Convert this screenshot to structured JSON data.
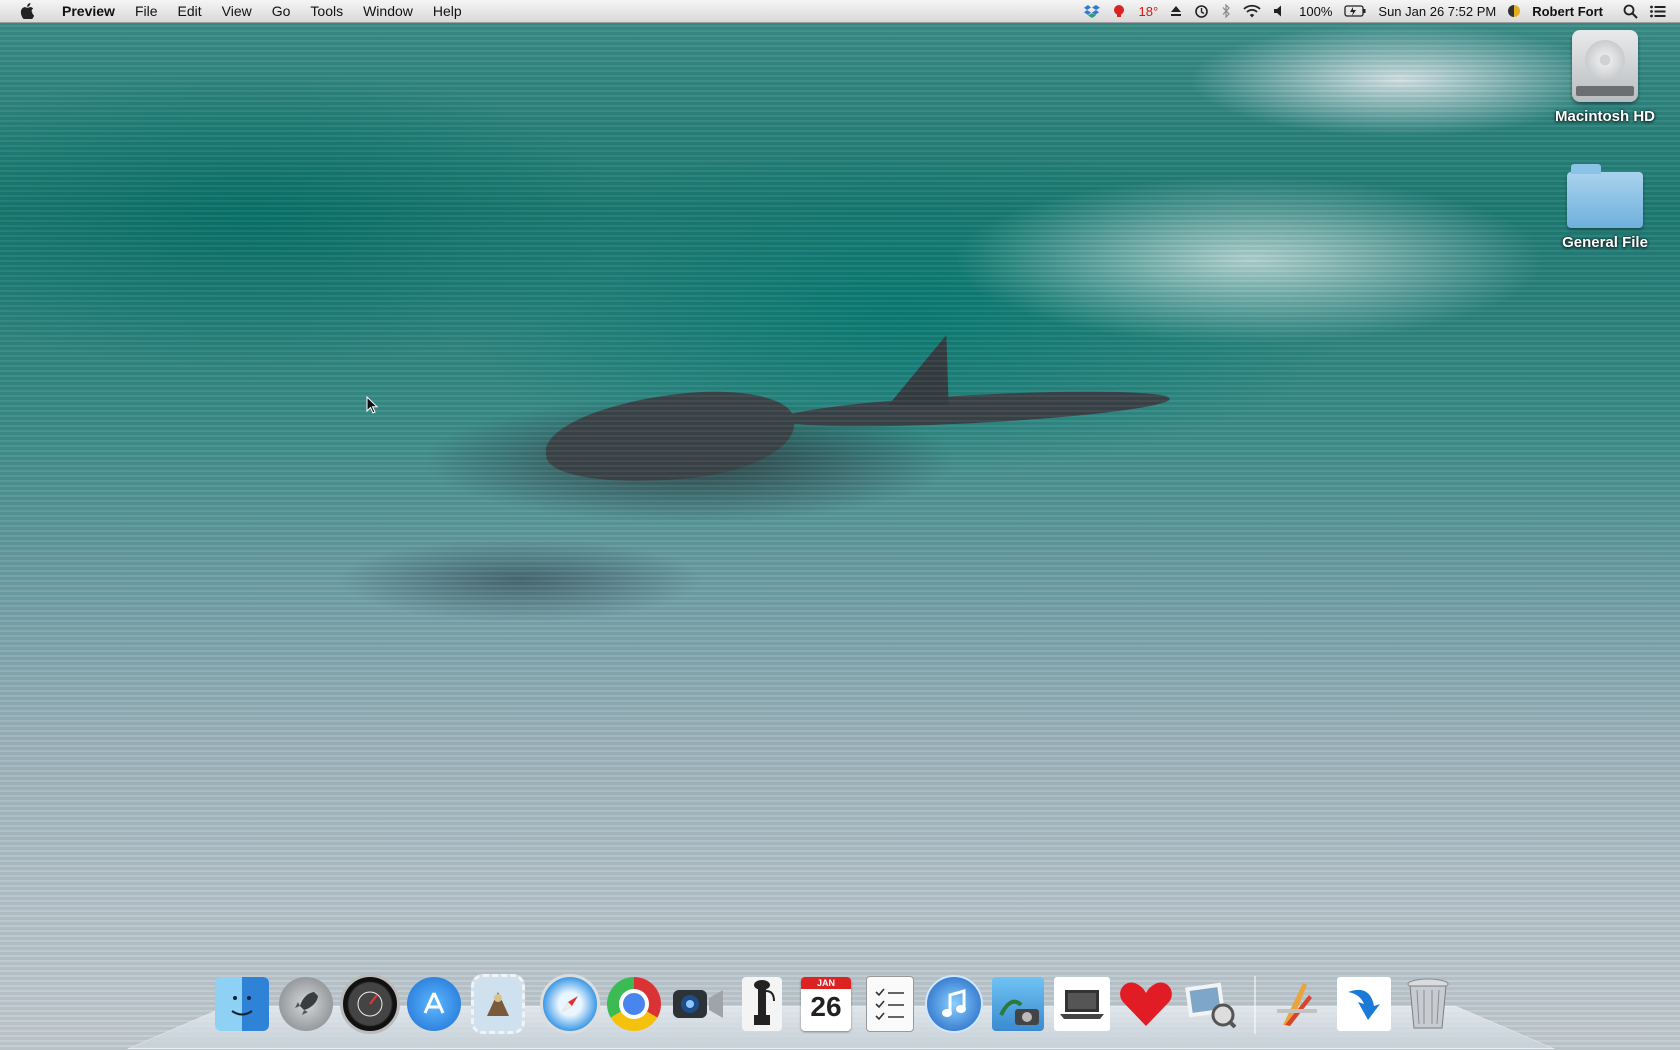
{
  "menubar": {
    "app_name": "Preview",
    "menus": [
      "File",
      "Edit",
      "View",
      "Go",
      "Tools",
      "Window",
      "Help"
    ],
    "status": {
      "temperature": "18°",
      "battery": "100%",
      "datetime": "Sun Jan 26  7:52 PM",
      "user": "Robert Fort"
    }
  },
  "desktop_icons": {
    "hd": "Macintosh HD",
    "folder": "General File"
  },
  "dock": {
    "calendar": {
      "month": "JAN",
      "day": "26"
    },
    "items": [
      "Finder",
      "Launchpad",
      "Dashboard",
      "App Store",
      "Mail",
      "Safari",
      "Google Chrome",
      "FaceTime",
      "Phone Utility",
      "Calendar",
      "Reminders",
      "iTunes",
      "iPhoto",
      "Laptop Utility",
      "Favorites",
      "Preview",
      "Xcode",
      "Downloads",
      "Trash"
    ]
  },
  "colors": {
    "menubar_bg": "#e6e6e6",
    "temperature": "#dd1111",
    "desktop_teal": "#1f7a73"
  }
}
